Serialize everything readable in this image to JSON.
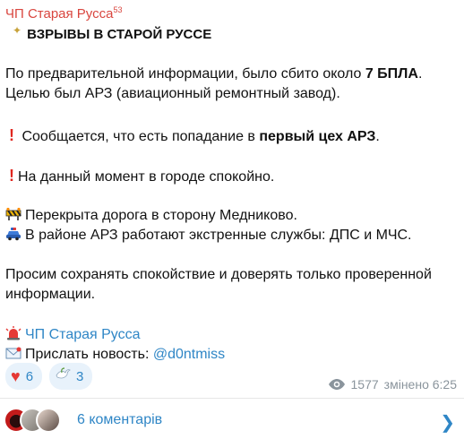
{
  "channel": {
    "name": "ЧП Старая Русса",
    "badge": "53"
  },
  "post": {
    "title": "ВЗРЫВЫ В СТАРОЙ РУССЕ",
    "p1_pre": "По предварительной информации, было сбито около ",
    "p1_bold": "7 БПЛА",
    "p1_post": ".",
    "p2": "Целью был АРЗ (авиационный ремонтный завод).",
    "p3_pre": "Сообщается, что есть попадание в ",
    "p3_bold": "первый цех АРЗ",
    "p3_post": ".",
    "p4": "На данный момент в городе спокойно.",
    "p5": "Перекрыта дорога в сторону Медниково.",
    "p6": "В районе АРЗ работают экстренные службы: ДПС и МЧС.",
    "p7": "Просим сохранять спокойствие и доверять только проверенной",
    "p8": "информации.",
    "sig_channel": "ЧП Старая Русса",
    "sig_send_label": "Прислать новость: ",
    "sig_handle": "@d0ntmiss"
  },
  "icons": {
    "sparkle": "sparkle-icon",
    "exclamation": "red-exclamation-icon",
    "construction": "construction-barrier-icon",
    "police_car": "police-car-icon",
    "siren": "siren-icon",
    "envelope": "envelope-icon"
  },
  "reactions": [
    {
      "icon": "heart-icon",
      "count": "6"
    },
    {
      "icon": "dove-icon",
      "count": "3"
    }
  ],
  "stats": {
    "views": "1577",
    "edited": "змінено 6:25"
  },
  "comments": {
    "label": "6 коментарів"
  },
  "colors": {
    "accent": "#2f86c6",
    "channel": "#d9463f",
    "alert": "#e0271f"
  }
}
